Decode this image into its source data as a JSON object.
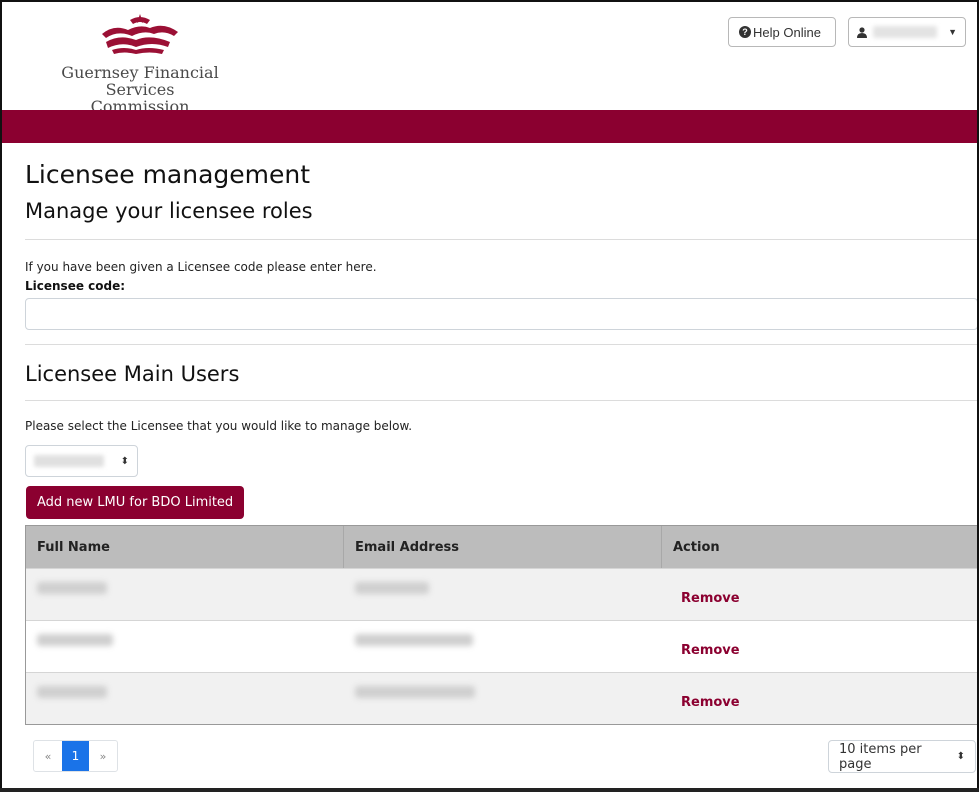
{
  "header": {
    "org_name_line1": "Guernsey Financial",
    "org_name_line2": "Services Commission",
    "help_label": "Help Online",
    "user_menu_caret": "▼",
    "brand_color": "#8b0030"
  },
  "page": {
    "title": "Licensee management",
    "subtitle": "Manage your licensee roles",
    "code_instruction": "If you have been given a Licensee code please enter here.",
    "code_label": "Licensee code:",
    "code_value": "",
    "code_placeholder": ""
  },
  "main_users": {
    "heading": "Licensee Main Users",
    "select_instruction": "Please select the Licensee that you would like to manage below.",
    "add_button_label": "Add new LMU for BDO Limited",
    "columns": [
      "Full Name",
      "Email Address",
      "Action"
    ],
    "rows": [
      {
        "action": "Remove"
      },
      {
        "action": "Remove"
      },
      {
        "action": "Remove"
      }
    ]
  },
  "pagination": {
    "prev": "«",
    "current": "1",
    "next": "»",
    "per_page": "10 items per page"
  },
  "icons": {
    "help": "question-circle-icon",
    "user": "user-icon",
    "select_arrows": "sort-arrows-icon"
  }
}
